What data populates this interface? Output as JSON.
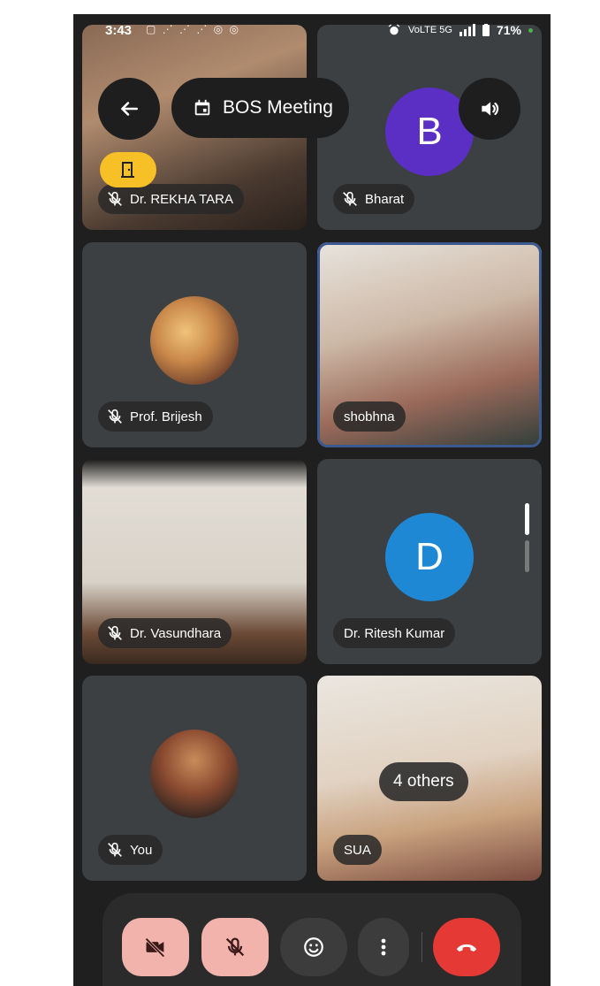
{
  "status_bar": {
    "time": "3:43",
    "notification_icons": "▢ ⋰ ⋰ ⋰ ◎ ◎",
    "network": "VoLTE 5G",
    "battery": "71%"
  },
  "meeting": {
    "title": "BOS Meeting"
  },
  "participants": [
    {
      "name": "Dr. REKHA TARA",
      "muted": true
    },
    {
      "name": "Bharat",
      "initial": "B",
      "avatar_color": "#5b2ec4",
      "muted": true
    },
    {
      "name": "Prof. Brijesh",
      "muted": true
    },
    {
      "name": "shobhna",
      "muted": false
    },
    {
      "name": "Dr. Vasundhara",
      "muted": true
    },
    {
      "name": "Dr. Ritesh Kumar",
      "initial": "D",
      "avatar_color": "#1e88d4",
      "muted": false
    },
    {
      "name": "You",
      "muted": true
    },
    {
      "name": "SUA",
      "muted": false
    }
  ],
  "others_label": "4 others",
  "colors": {
    "background": "#1f1f1f",
    "tile": "#3c4043",
    "toggle_off": "#f3b3ad",
    "end_call": "#e53935",
    "raise_hand": "#f6c026"
  },
  "icons": {
    "back": "arrow-left-icon",
    "calendar": "calendar-icon",
    "speaker": "speaker-icon",
    "exit": "door-icon",
    "mic_off": "mic-off-icon",
    "cam_off": "camera-off-icon",
    "emoji": "emoji-icon",
    "more": "more-vertical-icon",
    "end": "phone-hangup-icon"
  }
}
